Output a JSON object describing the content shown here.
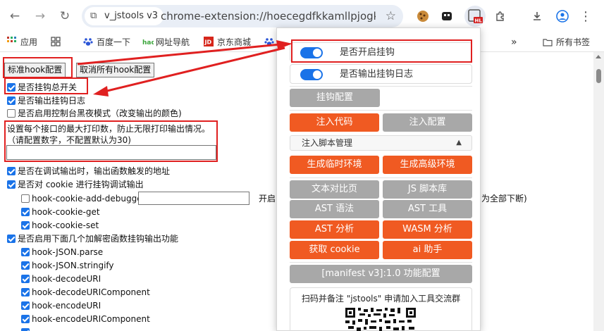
{
  "toolbar": {
    "back_icon": "back-arrow-icon",
    "forward_icon": "forward-arrow-icon",
    "reload_icon": "reload-icon",
    "site_chip_label": "v_jstools v3",
    "url": "chrome-extension://hoecegdfkkamllpjogk...",
    "star_icon": "bookmark-star-icon",
    "hl_badge": "HL"
  },
  "bookmarks": {
    "items": [
      "应用",
      "百度一下",
      "网址导航",
      "京东商城"
    ],
    "overflow": "»",
    "all_bookmarks": "所有书签"
  },
  "page": {
    "btn_standard": "标准hook配置",
    "btn_cancel": "取消所有hook配置",
    "opt_master": "是否挂钩总开关",
    "opt_log": "是否输出挂钩日志",
    "opt_dark": "是否启用控制台黑夜模式（改变输出的颜色)",
    "print_desc1": "设置每个接口的最大打印数，防止无限打印输出情况。",
    "print_desc2": "（请配置数字，不配置默认为30)",
    "opt_debug_addr": "是否在调试输出时，输出函数触发的地址",
    "opt_cookie": "是否对 cookie 进行挂钩调试输出",
    "cookie_add_debugger": "hook-cookie-add-debugger",
    "cookie_open_partial": "开启",
    "cookie_side_note": "为全部下断)",
    "cookie_get": "hook-cookie-get",
    "cookie_set": "hook-cookie-set",
    "opt_decode": "是否启用下面几个加解密函数挂钩输出功能",
    "hooks": [
      "hook-JSON.parse",
      "hook-JSON.stringify",
      "hook-decodeURI",
      "hook-decodeURIComponent",
      "hook-encodeURI",
      "hook-encodeURIComponent"
    ]
  },
  "popup": {
    "toggle_hook": "是否开启挂钩",
    "toggle_log": "是否输出挂钩日志",
    "btn_hook_config": "挂钩配置",
    "btn_inject_code": "注入代码",
    "btn_inject_config": "注入配置",
    "script_manage": "注入脚本管理",
    "script_manage_arrow": "▲",
    "btn_gen_temp_env": "生成临时环境",
    "btn_gen_adv_env": "生成高级环境",
    "btn_text_compare": "文本对比页",
    "btn_js_lib": "JS 脚本库",
    "btn_ast_syntax": "AST 语法",
    "btn_ast_tool": "AST 工具",
    "btn_ast_analyze": "AST 分析",
    "btn_wasm_analyze": "WASM 分析",
    "btn_get_cookie": "获取 cookie",
    "btn_ai": "ai 助手",
    "btn_manifest": "[manifest v3]:1.0 功能配置",
    "qr_label": "扫码并备注 \"jstools\" 申请加入工具交流群"
  },
  "colors": {
    "accent_blue": "#1a73e8",
    "orange": "#f05a22",
    "gray_button": "#a8a8a8",
    "highlight_red": "#e02020"
  }
}
